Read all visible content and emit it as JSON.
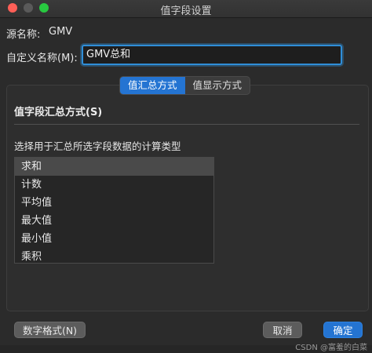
{
  "window": {
    "title": "值字段设置"
  },
  "fields": {
    "source_label": "源名称:",
    "source_value": "GMV",
    "custom_label": "自定义名称(M):",
    "custom_value": "GMV总和"
  },
  "tabs": [
    {
      "label": "值汇总方式",
      "active": true
    },
    {
      "label": "值显示方式",
      "active": false
    }
  ],
  "section": {
    "title": "值字段汇总方式(S)",
    "prompt": "选择用于汇总所选字段数据的计算类型"
  },
  "aggregations": [
    {
      "label": "求和",
      "selected": true
    },
    {
      "label": "计数",
      "selected": false
    },
    {
      "label": "平均值",
      "selected": false
    },
    {
      "label": "最大值",
      "selected": false
    },
    {
      "label": "最小值",
      "selected": false
    },
    {
      "label": "乘积",
      "selected": false
    }
  ],
  "buttons": {
    "number_format": "数字格式(N)",
    "cancel": "取消",
    "ok": "确定"
  },
  "watermark": "CSDN @富羞的白菜",
  "colors": {
    "accent": "#2474d2",
    "focus": "#2f8ed8"
  }
}
